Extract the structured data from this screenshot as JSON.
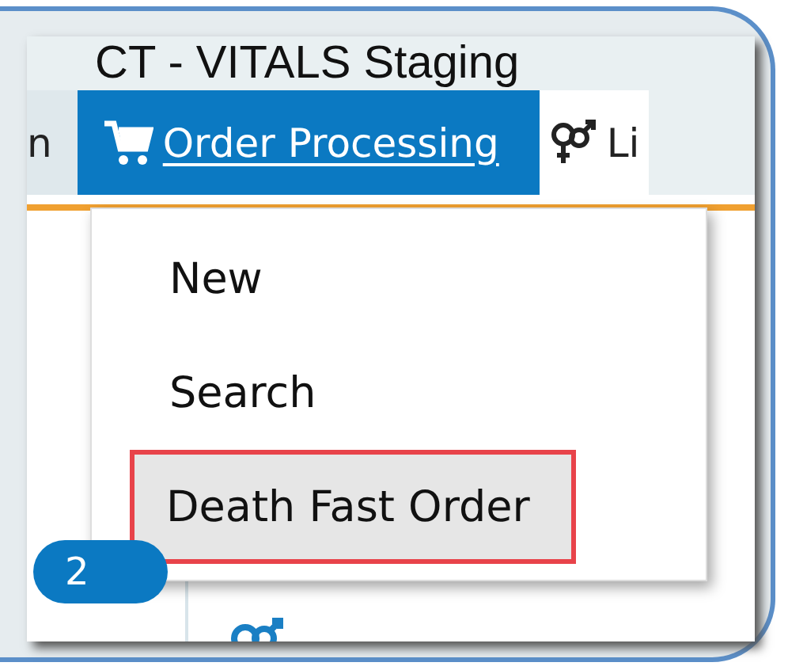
{
  "window": {
    "title": "CT - VITALS Staging"
  },
  "menu_bar": {
    "items": [
      {
        "label": "n",
        "kind": "plain",
        "selected": false
      },
      {
        "label": "Order Processing",
        "kind": "cart",
        "selected": true
      },
      {
        "label": "Li",
        "kind": "gender",
        "selected": false
      }
    ]
  },
  "dropdown": {
    "items": [
      {
        "label": "New",
        "selected": false
      },
      {
        "label": "Search",
        "selected": false
      },
      {
        "label": "Death Fast Order",
        "selected": true
      }
    ]
  },
  "badge": "2"
}
